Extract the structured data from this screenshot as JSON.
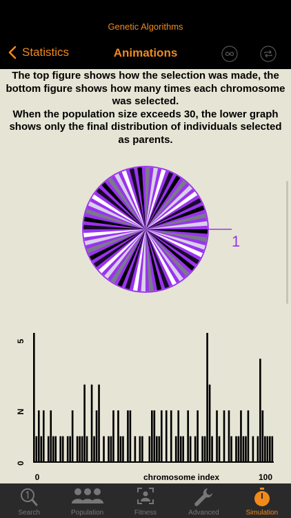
{
  "app": {
    "title": "Genetic Algorithms"
  },
  "nav": {
    "back_label": "Statistics",
    "title": "Animations",
    "icons": [
      "infinity-icon",
      "repeat-icon"
    ]
  },
  "description": [
    "The top figure shows how the selection was made, the bottom figure shows how many times each chromosome was selected.",
    "When the population size exceeds 30, the lower graph shows only the final distribution of individuals selected as parents."
  ],
  "wheel": {
    "pointer_label": "1",
    "colors": {
      "fill": "#9a33ee",
      "outline": "#9a33ee",
      "spokes": [
        "#000000",
        "#ffffff",
        "#7a7a8a",
        "#1a0a2a",
        "#d8d0e8"
      ]
    }
  },
  "chart_data": {
    "type": "bar",
    "title": "",
    "xlabel": "chromosome index",
    "ylabel": "",
    "x_ticks": [
      "0",
      "100"
    ],
    "y_ticks": [
      "0",
      "N",
      "5"
    ],
    "xlim": [
      0,
      100
    ],
    "ylim": [
      0,
      5
    ],
    "values": [
      5,
      1,
      2,
      1,
      2,
      0,
      1,
      2,
      1,
      1,
      0,
      1,
      1,
      0,
      1,
      1,
      2,
      0,
      1,
      1,
      1,
      3,
      1,
      0,
      3,
      1,
      2,
      3,
      0,
      1,
      0,
      1,
      1,
      2,
      0,
      2,
      1,
      1,
      0,
      2,
      2,
      0,
      1,
      0,
      1,
      1,
      0,
      0,
      1,
      2,
      2,
      1,
      1,
      2,
      0,
      2,
      0,
      2,
      0,
      1,
      2,
      1,
      1,
      0,
      2,
      1,
      0,
      1,
      2,
      0,
      1,
      1,
      5,
      3,
      1,
      0,
      2,
      1,
      0,
      2,
      0,
      2,
      1,
      0,
      1,
      1,
      2,
      1,
      1,
      2,
      0,
      1,
      0,
      1,
      4,
      2,
      1,
      1,
      1,
      1
    ]
  },
  "tabs": [
    {
      "label": "Search",
      "icon": "search-one-icon"
    },
    {
      "label": "Population",
      "icon": "people-icon"
    },
    {
      "label": "Fitness",
      "icon": "face-scan-icon"
    },
    {
      "label": "Advanced",
      "icon": "wrench-icon"
    },
    {
      "label": "Simulation",
      "icon": "stopwatch-icon"
    }
  ],
  "colors": {
    "accent": "#f08a1c",
    "background": "#e6e4d4",
    "bars": "#000000"
  }
}
